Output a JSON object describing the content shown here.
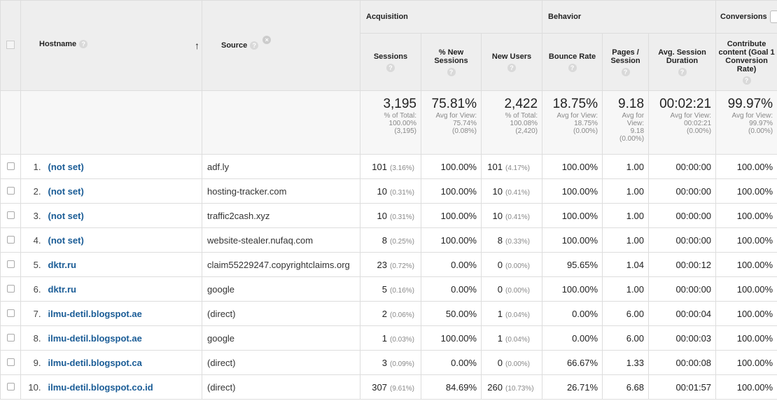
{
  "headers": {
    "hostname": "Hostname",
    "source": "Source",
    "groups": {
      "acquisition": "Acquisition",
      "behavior": "Behavior",
      "conversions": "Conversions"
    },
    "metrics": {
      "sessions": "Sessions",
      "new_sessions": "% New Sessions",
      "new_users": "New Users",
      "bounce_rate": "Bounce Rate",
      "pages_session": "Pages / Session",
      "avg_duration": "Avg. Session Duration",
      "contribute": "Contribute content (Goal 1 Conversion Rate)"
    },
    "help_glyph": "?",
    "sort_glyph": "↑",
    "remove_glyph": "×"
  },
  "totals": {
    "sessions": {
      "value": "3,195",
      "l1": "% of Total:",
      "l2": "100.00%",
      "l3": "(3,195)"
    },
    "new_sessions": {
      "value": "75.81%",
      "l1": "Avg for View:",
      "l2": "75.74%",
      "l3": "(0.08%)"
    },
    "new_users": {
      "value": "2,422",
      "l1": "% of Total:",
      "l2": "100.08%",
      "l3": "(2,420)"
    },
    "bounce_rate": {
      "value": "18.75%",
      "l1": "Avg for View:",
      "l2": "18.75%",
      "l3": "(0.00%)"
    },
    "pages_session": {
      "value": "9.18",
      "l1": "Avg for",
      "l2": "View:",
      "l3": "9.18",
      "l4": "(0.00%)"
    },
    "avg_duration": {
      "value": "00:02:21",
      "l1": "Avg for View:",
      "l2": "00:02:21",
      "l3": "(0.00%)"
    },
    "contribute": {
      "value": "99.97%",
      "l1": "Avg for View:",
      "l2": "99.97%",
      "l3": "(0.00%)"
    }
  },
  "rows": [
    {
      "idx": "1.",
      "host": "(not set)",
      "source": "adf.ly",
      "sessions": "101",
      "sessions_pct": "(3.16%)",
      "new_sessions": "100.00%",
      "new_users": "101",
      "new_users_pct": "(4.17%)",
      "bounce": "100.00%",
      "pages": "1.00",
      "duration": "00:00:00",
      "contribute": "100.00%"
    },
    {
      "idx": "2.",
      "host": "(not set)",
      "source": "hosting-tracker.com",
      "sessions": "10",
      "sessions_pct": "(0.31%)",
      "new_sessions": "100.00%",
      "new_users": "10",
      "new_users_pct": "(0.41%)",
      "bounce": "100.00%",
      "pages": "1.00",
      "duration": "00:00:00",
      "contribute": "100.00%"
    },
    {
      "idx": "3.",
      "host": "(not set)",
      "source": "traffic2cash.xyz",
      "sessions": "10",
      "sessions_pct": "(0.31%)",
      "new_sessions": "100.00%",
      "new_users": "10",
      "new_users_pct": "(0.41%)",
      "bounce": "100.00%",
      "pages": "1.00",
      "duration": "00:00:00",
      "contribute": "100.00%"
    },
    {
      "idx": "4.",
      "host": "(not set)",
      "source": "website-stealer.nufaq.com",
      "sessions": "8",
      "sessions_pct": "(0.25%)",
      "new_sessions": "100.00%",
      "new_users": "8",
      "new_users_pct": "(0.33%)",
      "bounce": "100.00%",
      "pages": "1.00",
      "duration": "00:00:00",
      "contribute": "100.00%"
    },
    {
      "idx": "5.",
      "host": "dktr.ru",
      "source": "claim55229247.copyrightclaims.org",
      "sessions": "23",
      "sessions_pct": "(0.72%)",
      "new_sessions": "0.00%",
      "new_users": "0",
      "new_users_pct": "(0.00%)",
      "bounce": "95.65%",
      "pages": "1.04",
      "duration": "00:00:12",
      "contribute": "100.00%"
    },
    {
      "idx": "6.",
      "host": "dktr.ru",
      "source": "google",
      "sessions": "5",
      "sessions_pct": "(0.16%)",
      "new_sessions": "0.00%",
      "new_users": "0",
      "new_users_pct": "(0.00%)",
      "bounce": "100.00%",
      "pages": "1.00",
      "duration": "00:00:00",
      "contribute": "100.00%"
    },
    {
      "idx": "7.",
      "host": "ilmu-detil.blogspot.ae",
      "source": "(direct)",
      "sessions": "2",
      "sessions_pct": "(0.06%)",
      "new_sessions": "50.00%",
      "new_users": "1",
      "new_users_pct": "(0.04%)",
      "bounce": "0.00%",
      "pages": "6.00",
      "duration": "00:00:04",
      "contribute": "100.00%"
    },
    {
      "idx": "8.",
      "host": "ilmu-detil.blogspot.ae",
      "source": "google",
      "sessions": "1",
      "sessions_pct": "(0.03%)",
      "new_sessions": "100.00%",
      "new_users": "1",
      "new_users_pct": "(0.04%)",
      "bounce": "0.00%",
      "pages": "6.00",
      "duration": "00:00:03",
      "contribute": "100.00%"
    },
    {
      "idx": "9.",
      "host": "ilmu-detil.blogspot.ca",
      "source": "(direct)",
      "sessions": "3",
      "sessions_pct": "(0.09%)",
      "new_sessions": "0.00%",
      "new_users": "0",
      "new_users_pct": "(0.00%)",
      "bounce": "66.67%",
      "pages": "1.33",
      "duration": "00:00:08",
      "contribute": "100.00%"
    },
    {
      "idx": "10.",
      "host": "ilmu-detil.blogspot.co.id",
      "source": "(direct)",
      "sessions": "307",
      "sessions_pct": "(9.61%)",
      "new_sessions": "84.69%",
      "new_users": "260",
      "new_users_pct": "(10.73%)",
      "bounce": "26.71%",
      "pages": "6.68",
      "duration": "00:01:57",
      "contribute": "100.00%"
    }
  ]
}
